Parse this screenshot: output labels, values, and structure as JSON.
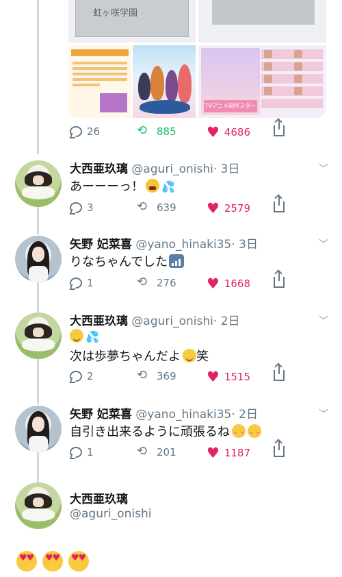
{
  "media": {
    "card_text": "虹ヶ咲学園",
    "band_text": "TVアニメ制作スタート!!"
  },
  "tweets": [
    {
      "id": "t0",
      "actions": {
        "replies": "26",
        "retweets": "885",
        "likes": "4686"
      }
    },
    {
      "id": "t1",
      "name": "大西亜玖璃",
      "handle": "@aguri_onishi",
      "time": "· 3日",
      "text": "あーーーっ！",
      "emoji": [
        "weary-face",
        "sweat-droplets"
      ],
      "actions": {
        "replies": "3",
        "retweets": "639",
        "likes": "2579"
      }
    },
    {
      "id": "t2",
      "name": "矢野 妃菜喜",
      "handle": "@yano_hinaki35",
      "time": "· 3日",
      "text": "りなちゃんでした",
      "emoji": [
        "antenna-bars"
      ],
      "actions": {
        "replies": "1",
        "retweets": "276",
        "likes": "1668"
      }
    },
    {
      "id": "t3",
      "name": "大西亜玖璃",
      "handle": "@aguri_onishi",
      "time": "· 2日",
      "line1_emoji": [
        "relieved-face",
        "sweat-droplets"
      ],
      "line2_text": "次は歩夢ちゃんだよ",
      "line2_suffix": "笑",
      "actions": {
        "replies": "2",
        "retweets": "369",
        "likes": "1515"
      }
    },
    {
      "id": "t4",
      "name": "矢野 妃菜喜",
      "handle": "@yano_hinaki35",
      "time": "· 2日",
      "text": "自引き出来るように頑張るね",
      "emoji": [
        "blush-face",
        "blush-face"
      ],
      "actions": {
        "replies": "1",
        "retweets": "201",
        "likes": "1187"
      }
    },
    {
      "id": "t5",
      "name": "大西亜玖璃",
      "handle": "@aguri_onishi",
      "emoji": [
        "heart-eyes-face",
        "heart-eyes-face",
        "heart-eyes-face"
      ]
    }
  ],
  "colors": {
    "like": "#e0245e",
    "retweet_active": "#17bf63",
    "muted": "#657786"
  }
}
